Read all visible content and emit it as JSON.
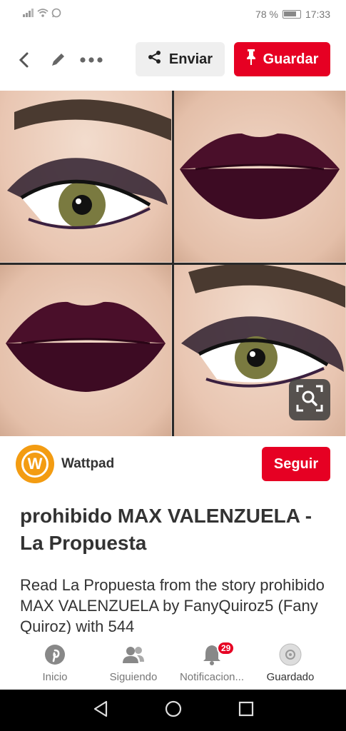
{
  "status_bar": {
    "battery": "78 %",
    "time": "17:33",
    "icons": [
      "signal-icon",
      "wifi-icon",
      "whatsapp-icon",
      "battery-icon"
    ]
  },
  "topbar": {
    "send_label": "Enviar",
    "save_label": "Guardar",
    "icons": [
      "back-arrow-icon",
      "edit-pencil-icon",
      "more-options-icon",
      "share-icon",
      "pin-icon"
    ]
  },
  "pin": {
    "image_icons": [
      "visual-search-icon"
    ]
  },
  "creator": {
    "name": "Wattpad",
    "follow_label": "Seguir",
    "avatar_letter": "W"
  },
  "title": "prohibido MAX VALENZUELA - La Propuesta",
  "description": "Read La Propuesta from the story prohibido MAX VALENZUELA by FanyQuiroz5 (Fany Quiroz) with 544",
  "bottom_nav": {
    "items": [
      {
        "label": "Inicio"
      },
      {
        "label": "Siguiendo"
      },
      {
        "label": "Notificacion..."
      },
      {
        "label": "Guardado"
      }
    ],
    "notification_count": "29"
  },
  "colors": {
    "brand_red": "#e60023",
    "wattpad_orange": "#f39c12",
    "lip_color": "#4a0f2a"
  }
}
